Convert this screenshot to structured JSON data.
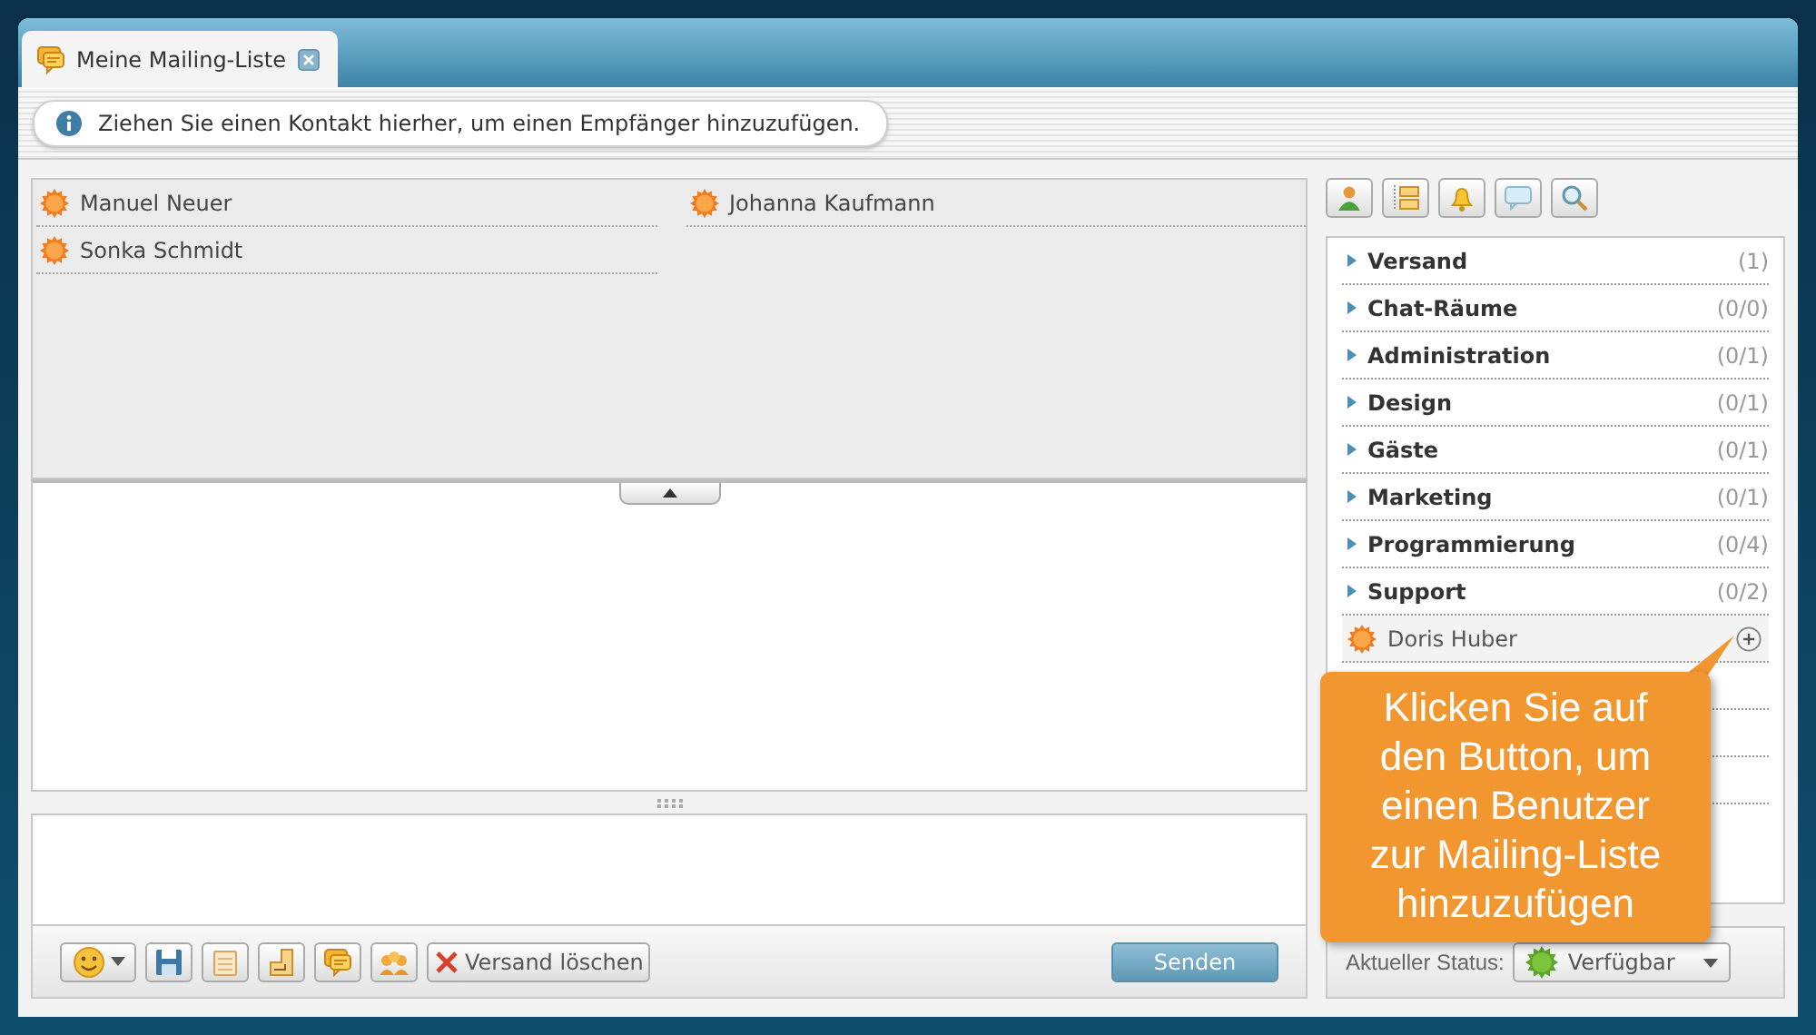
{
  "tab": {
    "label": "Meine Mailing-Liste",
    "selected": true
  },
  "info": "Ziehen Sie einen Kontakt hierher, um einen Empfänger hinzuzufügen.",
  "recipients": [
    {
      "name": "Manuel Neuer"
    },
    {
      "name": "Johanna Kaufmann"
    },
    {
      "name": "Sonka Schmidt"
    }
  ],
  "delete_button": "Versand löschen",
  "send_button": "Senden",
  "groups": [
    {
      "kind": "group",
      "label": "Versand",
      "count": "(1)"
    },
    {
      "kind": "group",
      "label": "Chat-Räume",
      "count": "(0/0)"
    },
    {
      "kind": "group",
      "label": "Administration",
      "count": "(0/1)"
    },
    {
      "kind": "group",
      "label": "Design",
      "count": "(0/1)"
    },
    {
      "kind": "group",
      "label": "Gäste",
      "count": "(0/1)"
    },
    {
      "kind": "group",
      "label": "Marketing",
      "count": "(0/1)"
    },
    {
      "kind": "group",
      "label": "Programmierung",
      "count": "(0/4)"
    },
    {
      "kind": "group",
      "label": "Support",
      "count": "(0/2)"
    },
    {
      "kind": "contact",
      "label": "Doris Huber"
    }
  ],
  "tooltip": "Klicken Sie auf den Button, um einen Benutzer zur Mailing-Liste hinzuzufügen",
  "status": {
    "label": "Aktueller Status:",
    "value": "Verfügbar"
  }
}
